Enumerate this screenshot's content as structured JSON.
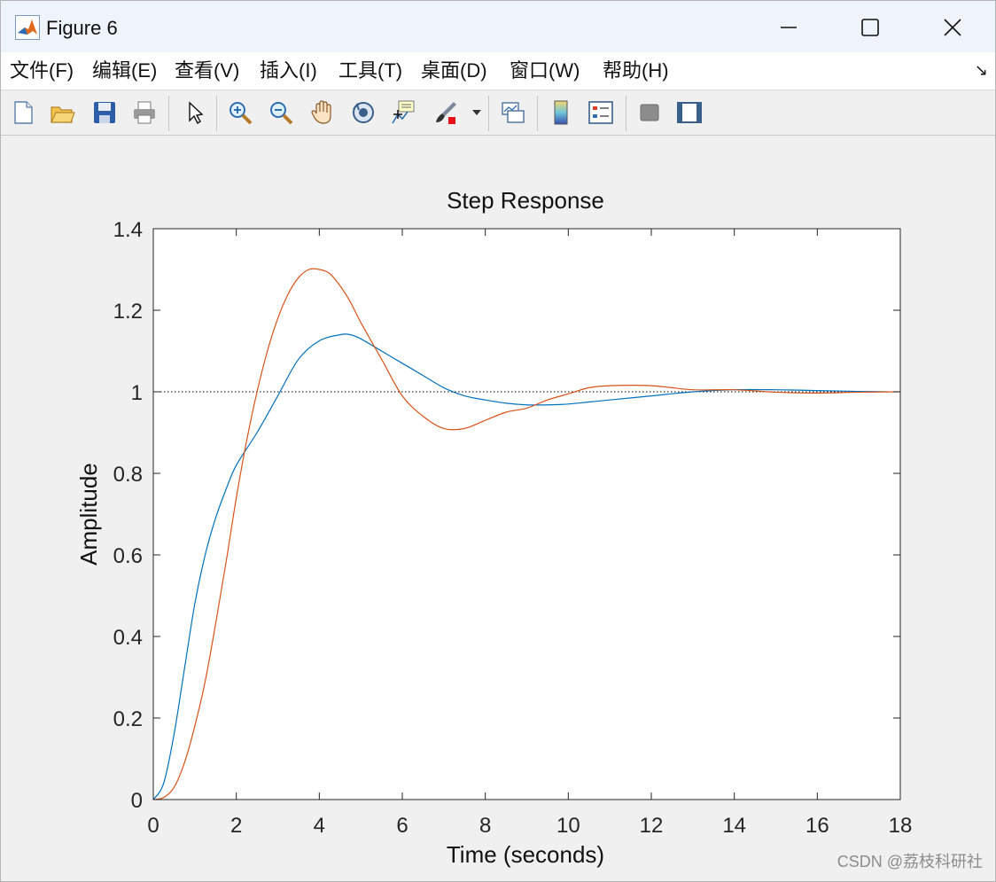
{
  "window": {
    "title": "Figure 6",
    "icons": {
      "app": "matlab-logo-icon",
      "minimize": "minimize-icon",
      "maximize": "maximize-icon",
      "close": "close-icon"
    }
  },
  "menu": {
    "items": [
      "文件(F)",
      "编辑(E)",
      "查看(V)",
      "插入(I)",
      "工具(T)",
      "桌面(D)",
      "窗口(W)",
      "帮助(H)"
    ],
    "dock_arrow": "↘"
  },
  "toolbar": {
    "buttons": [
      "new-figure-icon",
      "open-file-icon",
      "save-icon",
      "print-icon",
      "edit-plot-pointer-icon",
      "zoom-in-icon",
      "zoom-out-icon",
      "pan-hand-icon",
      "rotate-3d-icon",
      "data-cursor-icon",
      "brush-icon",
      "link-plot-icon",
      "colorbar-icon",
      "legend-icon",
      "hide-plot-tools-icon",
      "show-plot-tools-icon"
    ]
  },
  "chart_data": {
    "type": "line",
    "title": "Step Response",
    "xlabel": "Time (seconds)",
    "ylabel": "Amplitude",
    "xlim": [
      0,
      18
    ],
    "ylim": [
      0,
      1.4
    ],
    "xticks": [
      "0",
      "2",
      "4",
      "6",
      "8",
      "10",
      "12",
      "14",
      "16",
      "18"
    ],
    "yticks": [
      "0",
      "0.2",
      "0.4",
      "0.6",
      "0.8",
      "1",
      "1.2",
      "1.4"
    ],
    "reference_line": {
      "y": 1,
      "style": "dotted",
      "color": "#000000"
    },
    "grid": false,
    "series": [
      {
        "color": "#0072bd",
        "x": [
          0,
          0.25,
          0.5,
          0.75,
          1,
          1.25,
          1.5,
          1.75,
          2,
          2.5,
          3,
          3.5,
          4,
          4.5,
          4.75,
          5,
          5.5,
          6,
          6.5,
          7,
          7.5,
          8,
          8.5,
          9,
          9.5,
          10,
          10.5,
          11,
          12,
          13,
          14,
          15,
          16,
          17,
          17.7
        ],
        "values": [
          0,
          0.04,
          0.16,
          0.32,
          0.48,
          0.6,
          0.69,
          0.76,
          0.82,
          0.9,
          0.99,
          1.08,
          1.125,
          1.14,
          1.14,
          1.13,
          1.1,
          1.07,
          1.04,
          1.01,
          0.99,
          0.98,
          0.972,
          0.968,
          0.968,
          0.97,
          0.975,
          0.98,
          0.99,
          1.0,
          1.005,
          1.005,
          1.003,
          1.001,
          1.0
        ]
      },
      {
        "color": "#d95319",
        "x": [
          0,
          0.25,
          0.5,
          0.75,
          1,
          1.25,
          1.5,
          1.75,
          2,
          2.25,
          2.5,
          2.75,
          3,
          3.25,
          3.5,
          3.75,
          4,
          4.25,
          4.5,
          4.75,
          5,
          5.5,
          6,
          6.5,
          7,
          7.5,
          8,
          8.5,
          9,
          9.5,
          10,
          10.5,
          11,
          12,
          13,
          14,
          15,
          16,
          17,
          18
        ],
        "values": [
          0,
          0.005,
          0.03,
          0.09,
          0.18,
          0.29,
          0.43,
          0.58,
          0.74,
          0.88,
          1.0,
          1.1,
          1.18,
          1.24,
          1.28,
          1.3,
          1.3,
          1.29,
          1.26,
          1.22,
          1.17,
          1.08,
          0.99,
          0.94,
          0.91,
          0.91,
          0.93,
          0.95,
          0.96,
          0.98,
          0.995,
          1.01,
          1.015,
          1.015,
          1.005,
          1.005,
          0.999,
          0.997,
          0.999,
          1.0
        ]
      }
    ]
  },
  "watermark": "CSDN @荔枝科研社"
}
